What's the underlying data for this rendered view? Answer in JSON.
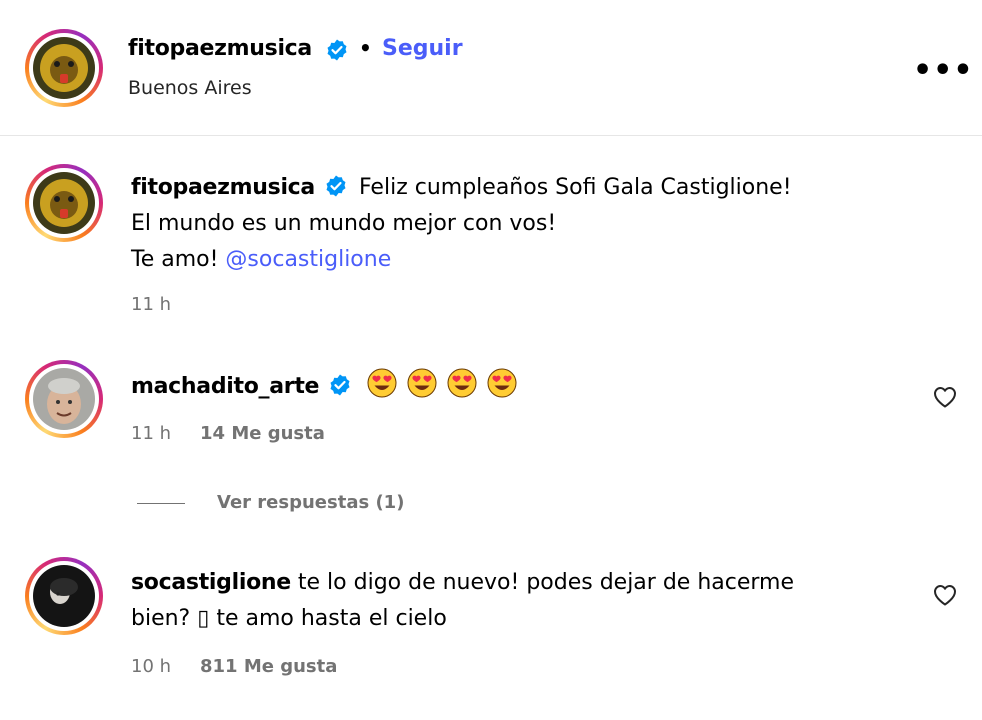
{
  "post_header": {
    "username": "fitopaezmusica",
    "separator": "•",
    "follow_label": "Seguir",
    "location": "Buenos Aires",
    "more_label": "•••"
  },
  "caption": {
    "username": "fitopaezmusica",
    "line1": "Feliz cumpleaños Sofi Gala Castiglione!",
    "line2": "El mundo es un mundo mejor con vos!",
    "line3_prefix": "Te amo!",
    "mention": "@socastiglione",
    "time": "11 h"
  },
  "comments": [
    {
      "username": "machadito_arte",
      "emojis": [
        "heart-eyes",
        "heart-eyes",
        "heart-eyes",
        "heart-eyes"
      ],
      "time": "11 h",
      "likes": "14 Me gusta",
      "replies_label": "Ver respuestas (1)"
    },
    {
      "username": "socastiglione",
      "line1": "te lo digo de nuevo! podes dejar de hacerme",
      "line2": "bien? ▯ te amo hasta el cielo",
      "time": "10 h",
      "likes": "811 Me gusta"
    }
  ],
  "colors": {
    "link_blue": "#4a5df9",
    "verified_blue": "#0095f6",
    "meta_gray": "#737373"
  }
}
